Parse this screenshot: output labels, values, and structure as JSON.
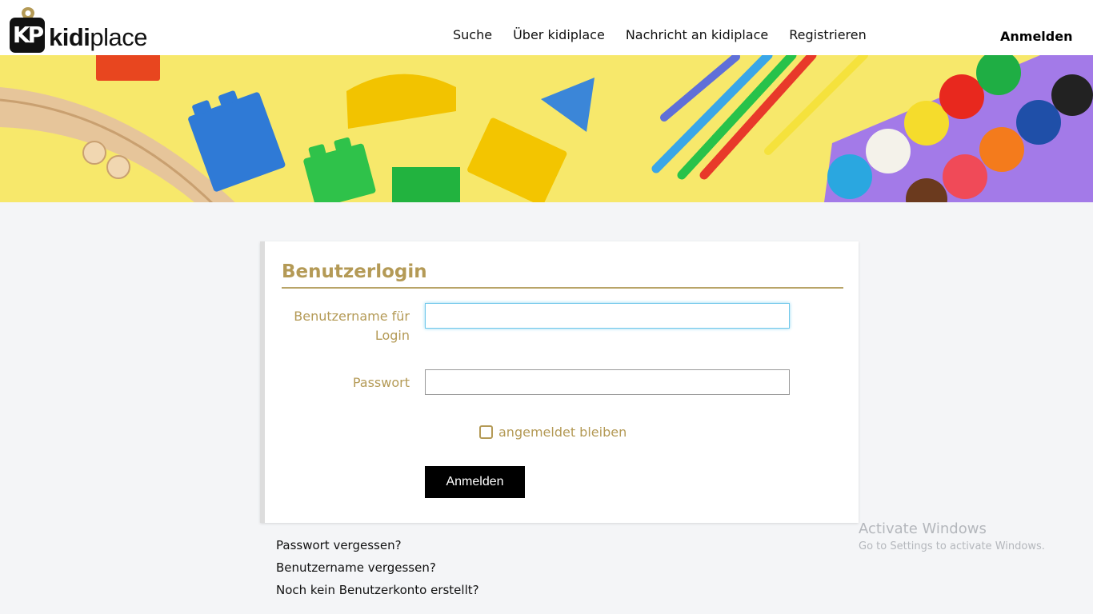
{
  "header": {
    "logo": {
      "mark": "KP",
      "brand_bold": "kidi",
      "brand_light": "place"
    },
    "nav": [
      {
        "label": "Suche"
      },
      {
        "label": "Über kidiplace"
      },
      {
        "label": "Nachricht an kidiplace"
      },
      {
        "label": "Registrieren"
      }
    ],
    "login_link": "Anmelden"
  },
  "login": {
    "title": "Benutzerlogin",
    "username_label": "Benutzername für Login",
    "username_value": "",
    "password_label": "Passwort",
    "password_value": "",
    "remember_label": "angemeldet bleiben",
    "remember_checked": false,
    "submit_label": "Anmelden"
  },
  "links": [
    {
      "label": "Passwort vergessen?"
    },
    {
      "label": "Benutzername vergessen?"
    },
    {
      "label": "Noch kein Benutzerkonto erstellt?"
    }
  ],
  "watermark": {
    "title": "Activate Windows",
    "subtitle": "Go to Settings to activate Windows."
  },
  "colors": {
    "accent": "#b49a56",
    "banner_bg": "#f7e86b",
    "page_bg": "#f4f5f7",
    "focus": "#6fc7ea"
  },
  "icons": [
    "location-pin-icon",
    "checkbox-icon"
  ]
}
